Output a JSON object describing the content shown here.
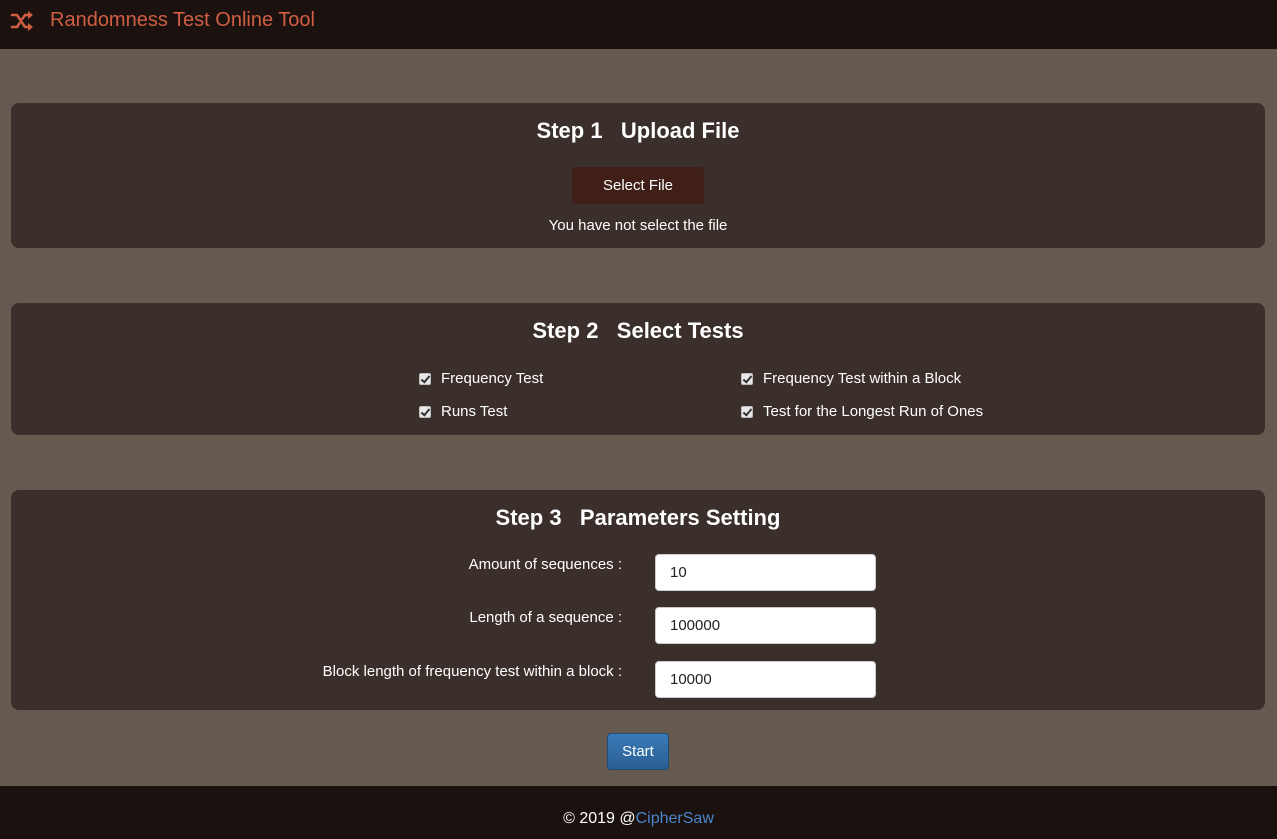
{
  "navbar": {
    "icon": "shuffle-icon",
    "title": "Randomness Test Online Tool",
    "title_color": "#cf5e42"
  },
  "step1": {
    "title": "Step 1   Upload File",
    "select_button": "Select File",
    "status": "You have not select the file"
  },
  "step2": {
    "title": "Step 2   Select Tests",
    "tests": [
      {
        "label": "Frequency Test",
        "checked": true
      },
      {
        "label": "Frequency Test within a Block",
        "checked": true
      },
      {
        "label": "Runs Test",
        "checked": true
      },
      {
        "label": "Test for the Longest Run of Ones",
        "checked": true
      }
    ]
  },
  "step3": {
    "title": "Step 3   Parameters Setting",
    "params": [
      {
        "label": "Amount of sequences :",
        "value": "10"
      },
      {
        "label": "Length of a sequence :",
        "value": "100000"
      },
      {
        "label": "Block length of frequency test within a block :",
        "value": "10000"
      }
    ]
  },
  "start_button": "Start",
  "footer": {
    "prefix": "© 2019 @",
    "link": "CipherSaw",
    "link_color": "#4a86c9"
  }
}
